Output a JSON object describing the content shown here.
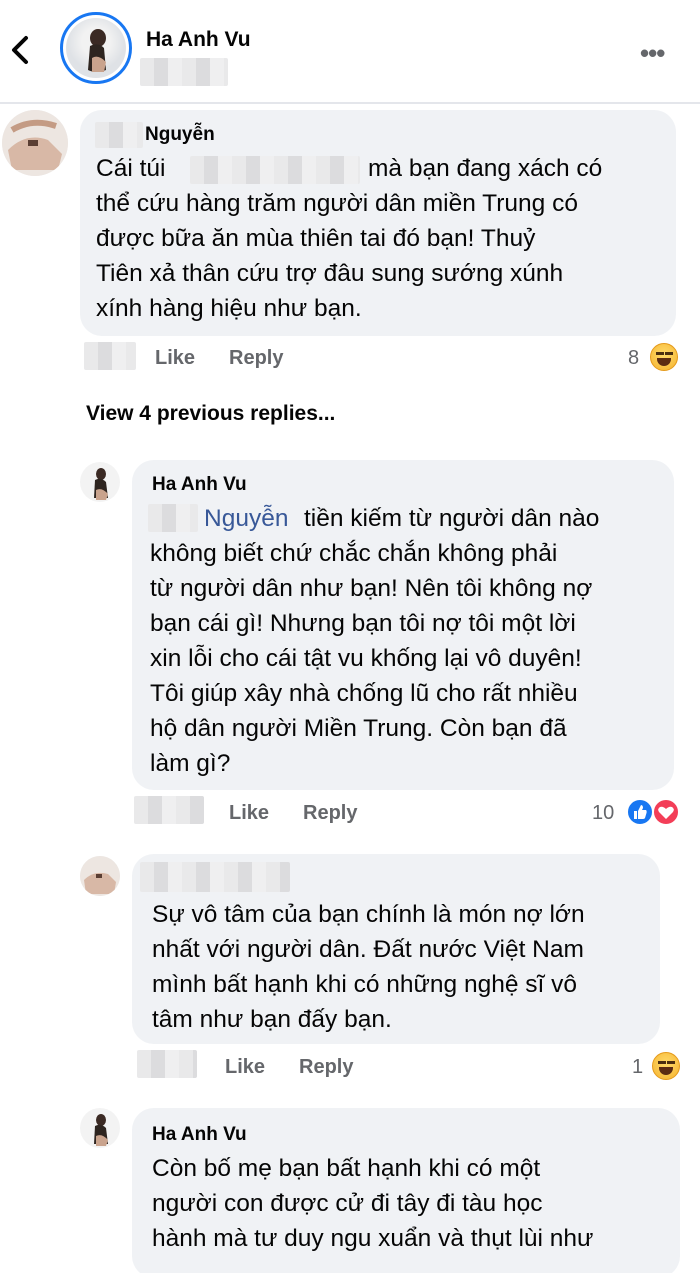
{
  "header": {
    "name": "Ha Anh Vu",
    "icons": {
      "back": "chevron-left-icon",
      "more": "more-horizontal-icon"
    }
  },
  "comments": [
    {
      "author": "Nguyễn",
      "lines": [
        "Cái túi",
        "mà bạn đang xách có",
        "thể cứu hàng trăm người dân miền Trung có",
        "được bữa ăn mùa thiên tai đó bạn! Thuỷ",
        "Tiên xả thân cứu trợ đâu sung sướng xúnh",
        "xính hàng hiệu như bạn."
      ],
      "like": "Like",
      "reply": "Reply",
      "reaction_count": "8",
      "reaction": "haha-icon"
    }
  ],
  "view_previous": "View 4 previous replies...",
  "replies": [
    {
      "author": "Ha Anh Vu",
      "mention": "Nguyễn",
      "lines": [
        "tiền kiếm từ người dân nào",
        "không biết chứ chắc chắn không phải",
        "từ người dân như bạn! Nên tôi không nợ",
        "bạn cái gì! Nhưng bạn tôi nợ tôi một lời",
        "xin lỗi cho cái tật vu khống lại vô duyên!",
        "Tôi giúp xây nhà chống lũ cho rất nhiều",
        "hộ dân người Miền Trung. Còn bạn đã",
        "làm gì?"
      ],
      "like": "Like",
      "reply": "Reply",
      "reaction_count": "10",
      "reactions": [
        "like-icon",
        "love-icon"
      ]
    },
    {
      "author": "",
      "lines": [
        "Sự vô tâm của bạn chính là món nợ lớn",
        "nhất với người dân. Đất nước Việt Nam",
        "mình bất hạnh khi có những nghệ sĩ vô",
        "tâm như bạn đấy bạn."
      ],
      "like": "Like",
      "reply": "Reply",
      "reaction_count": "1",
      "reaction": "haha-icon"
    },
    {
      "author": "Ha Anh Vu",
      "lines": [
        "Còn bố mẹ bạn bất hạnh khi có một",
        "người con được cử đi tây đi tàu học",
        "hành mà tư duy ngu xuẩn và thụt lùi như"
      ]
    }
  ]
}
